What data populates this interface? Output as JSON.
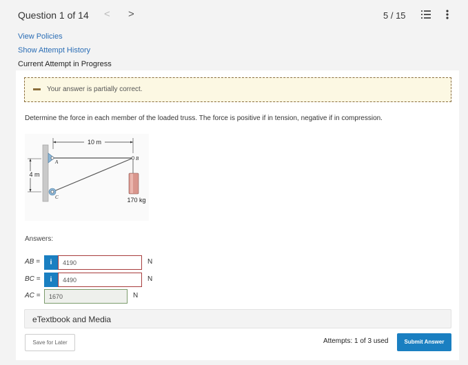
{
  "header": {
    "question_title": "Question 1 of 14",
    "prev_glyph": "<",
    "next_glyph": ">",
    "progress": "5 / 15",
    "icons": [
      "list-icon",
      "kebab-menu-icon"
    ]
  },
  "links": {
    "view_policies": "View Policies",
    "show_attempt_history": "Show Attempt History"
  },
  "attempt_status": "Current Attempt in Progress",
  "alert": {
    "text": "Your answer is partially correct.",
    "color": "#fcf8e3"
  },
  "problem": {
    "text": "Determine the force in each member of the loaded truss. The force is positive if in tension, negative if in compression."
  },
  "figure": {
    "dim_horizontal": "10 m",
    "dim_vertical": "4 m",
    "label_a": "A",
    "label_b": "B",
    "label_c": "C",
    "mass": "170 kg"
  },
  "answers": {
    "label": "Answers:",
    "rows": [
      {
        "label": "AB =",
        "value": "4190",
        "unit": "N",
        "info": "i",
        "status": "incorrect"
      },
      {
        "label": "BC =",
        "value": "4490",
        "unit": "N",
        "info": "i",
        "status": "incorrect"
      },
      {
        "label": "AC =",
        "value": "1670",
        "unit": "N",
        "status": "correct"
      }
    ]
  },
  "etextbook": "eTextbook and Media",
  "footer": {
    "save_label": "Save for Later",
    "attempts": "Attempts: 1 of 3 used",
    "submit_label": "Submit Answer"
  },
  "colors": {
    "accent": "#1a7fc1",
    "incorrect_border": "#a73b3b",
    "link": "#2a6db5"
  }
}
